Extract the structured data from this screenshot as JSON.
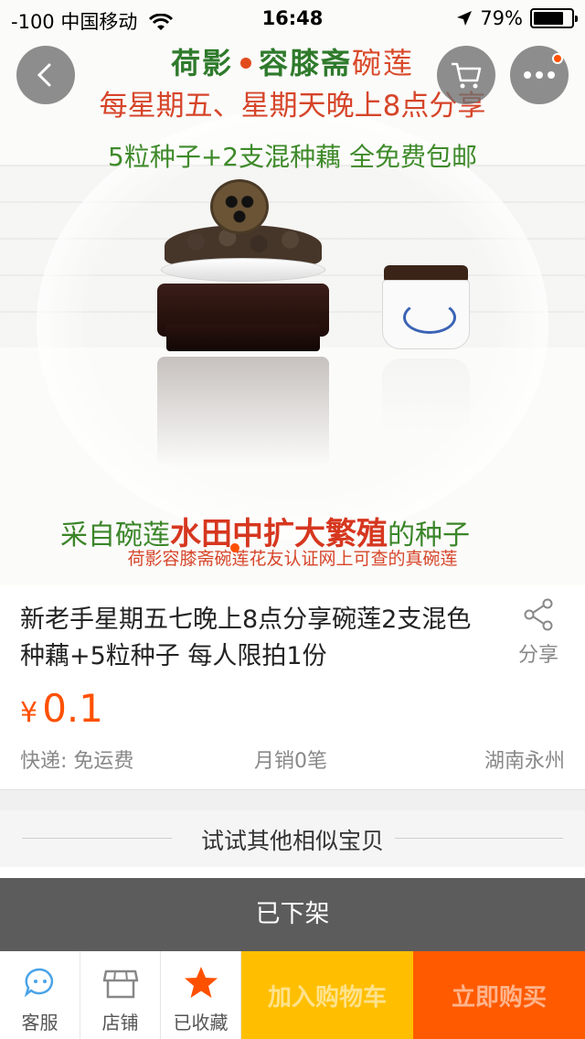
{
  "status_bar": {
    "signal": "-100",
    "carrier": "中国移动",
    "time": "16:48",
    "battery_text": "79%",
    "battery_level": 0.79
  },
  "nav": {
    "back_icon": "chevron-left-icon",
    "cart_icon": "cart-icon",
    "more_icon": "more-dots-icon"
  },
  "hero": {
    "line1_a": "荷影",
    "line1_b": "容膝斋",
    "line1_c": "碗莲",
    "line2": "每星期五、星期天晚上8点分享",
    "line3": "5粒种子+2支混种藕 全免费包邮",
    "line4_a": "采自碗莲",
    "line4_b": "水田中扩大繁殖",
    "line4_c": "的种子",
    "line5": "荷影容膝斋碗莲花友认证网上可查的真碗莲"
  },
  "product": {
    "title": "新老手星期五七晚上8点分享碗莲2支混色种藕+5粒种子 每人限拍1份",
    "share_label": "分享",
    "price_symbol": "¥",
    "price_value": "0.1",
    "shipping": "快递: 免运费",
    "monthly_sales": "月销0笔",
    "location": "湖南永州"
  },
  "similar": {
    "label": "试试其他相似宝贝"
  },
  "off_shelf": {
    "label": "已下架"
  },
  "bottom_bar": {
    "tabs": [
      {
        "label": "客服",
        "icon": "customer-service-icon"
      },
      {
        "label": "店铺",
        "icon": "shop-icon"
      },
      {
        "label": "已收藏",
        "icon": "star-icon"
      }
    ],
    "add_to_cart": "加入购物车",
    "buy_now": "立即购买"
  },
  "colors": {
    "accent": "#ff5000",
    "add_to_cart_bg": "#ffbf00",
    "buy_now_bg": "#ff5a00",
    "off_shelf_bg": "#5c5c5c"
  }
}
